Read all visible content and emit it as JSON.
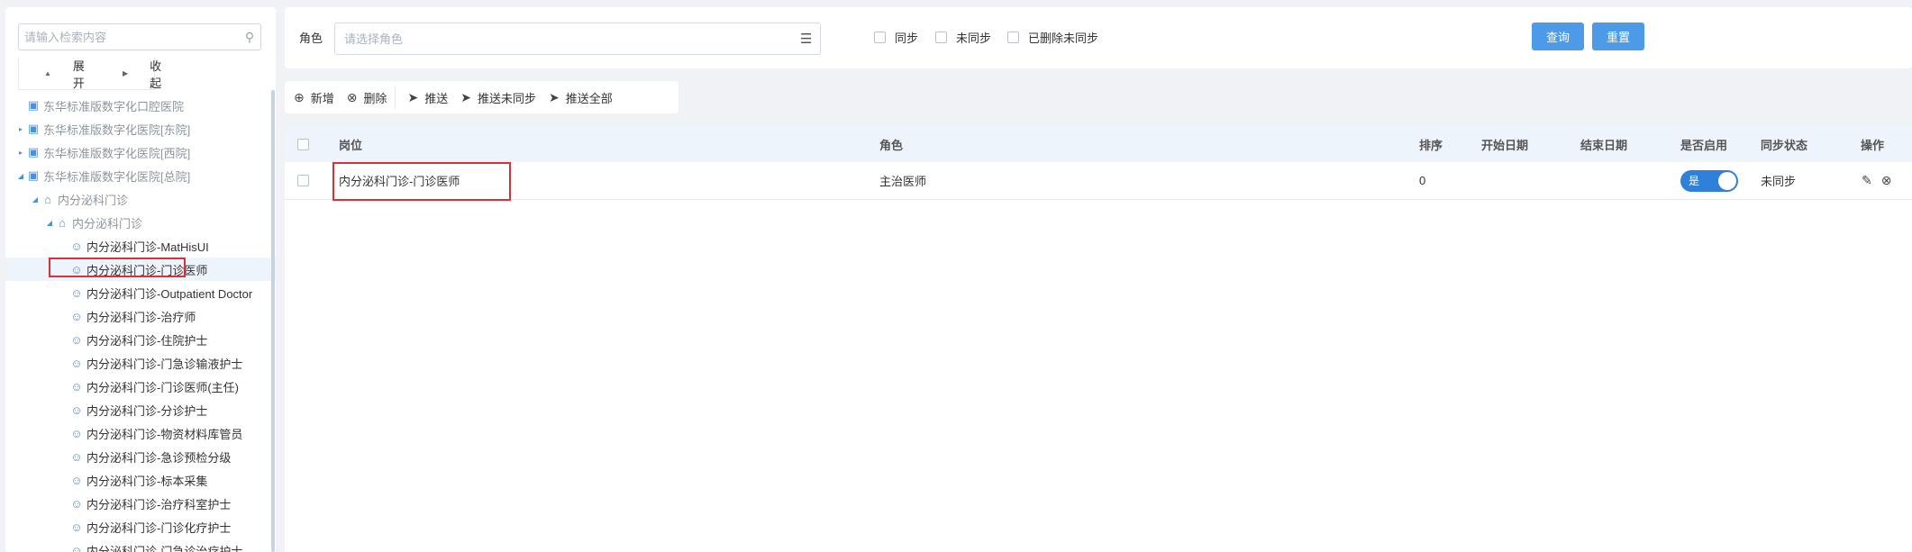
{
  "sidebar": {
    "search_placeholder": "请输入检索内容",
    "expand_label": "展开",
    "collapse_label": "收起",
    "tree": [
      {
        "label": "东华标准版数字化口腔医院",
        "icon": "hospital-icon",
        "level": 0,
        "arrow": "",
        "grey": true
      },
      {
        "label": "东华标准版数字化医院[东院]",
        "icon": "hospital-icon",
        "level": 0,
        "arrow": "right",
        "grey": true
      },
      {
        "label": "东华标准版数字化医院[西院]",
        "icon": "hospital-icon",
        "level": 0,
        "arrow": "right",
        "grey": true
      },
      {
        "label": "东华标准版数字化医院[总院]",
        "icon": "hospital-icon",
        "level": 0,
        "arrow": "down",
        "grey": true
      },
      {
        "label": "内分泌科门诊",
        "icon": "home-icon",
        "level": 1,
        "arrow": "down",
        "grey": true
      },
      {
        "label": "内分泌科门诊",
        "icon": "home-icon",
        "level": 2,
        "arrow": "down",
        "grey": true
      },
      {
        "label": "内分泌科门诊-MatHisUI",
        "icon": "user-icon",
        "level": 3,
        "arrow": "",
        "grey": false
      },
      {
        "label": "内分泌科门诊-门诊医师",
        "icon": "user-icon",
        "level": 3,
        "arrow": "",
        "grey": false,
        "selected": true
      },
      {
        "label": "内分泌科门诊-Outpatient Doctor",
        "icon": "user-icon",
        "level": 3,
        "arrow": "",
        "grey": false
      },
      {
        "label": "内分泌科门诊-治疗师",
        "icon": "user-icon",
        "level": 3,
        "arrow": "",
        "grey": false
      },
      {
        "label": "内分泌科门诊-住院护士",
        "icon": "user-icon",
        "level": 3,
        "arrow": "",
        "grey": false
      },
      {
        "label": "内分泌科门诊-门急诊输液护士",
        "icon": "user-icon",
        "level": 3,
        "arrow": "",
        "grey": false
      },
      {
        "label": "内分泌科门诊-门诊医师(主任)",
        "icon": "user-icon",
        "level": 3,
        "arrow": "",
        "grey": false
      },
      {
        "label": "内分泌科门诊-分诊护士",
        "icon": "user-icon",
        "level": 3,
        "arrow": "",
        "grey": false
      },
      {
        "label": "内分泌科门诊-物资材料库管员",
        "icon": "user-icon",
        "level": 3,
        "arrow": "",
        "grey": false
      },
      {
        "label": "内分泌科门诊-急诊预检分级",
        "icon": "user-icon",
        "level": 3,
        "arrow": "",
        "grey": false
      },
      {
        "label": "内分泌科门诊-标本采集",
        "icon": "user-icon",
        "level": 3,
        "arrow": "",
        "grey": false
      },
      {
        "label": "内分泌科门诊-治疗科室护士",
        "icon": "user-icon",
        "level": 3,
        "arrow": "",
        "grey": false
      },
      {
        "label": "内分泌科门诊-门诊化疗护士",
        "icon": "user-icon",
        "level": 3,
        "arrow": "",
        "grey": false
      },
      {
        "label": "内分泌科门诊-门急诊治疗护士",
        "icon": "user-icon",
        "level": 3,
        "arrow": "",
        "grey": false
      }
    ]
  },
  "filter": {
    "role_label": "角色",
    "role_placeholder": "请选择角色",
    "checkboxes": [
      "同步",
      "未同步",
      "已删除未同步"
    ],
    "query_label": "查询",
    "reset_label": "重置"
  },
  "toolbar": {
    "add": "新增",
    "delete": "删除",
    "push": "推送",
    "push_unsynced": "推送未同步",
    "push_all": "推送全部"
  },
  "grid": {
    "columns": {
      "post": "岗位",
      "role": "角色",
      "order": "排序",
      "start": "开始日期",
      "end": "结束日期",
      "enabled": "是否启用",
      "sync": "同步状态",
      "ops": "操作"
    },
    "rows": [
      {
        "post": "内分泌科门诊-门诊医师",
        "role": "主治医师",
        "order": "0",
        "start": "",
        "end": "",
        "enabled": "是",
        "sync": "未同步"
      }
    ]
  }
}
